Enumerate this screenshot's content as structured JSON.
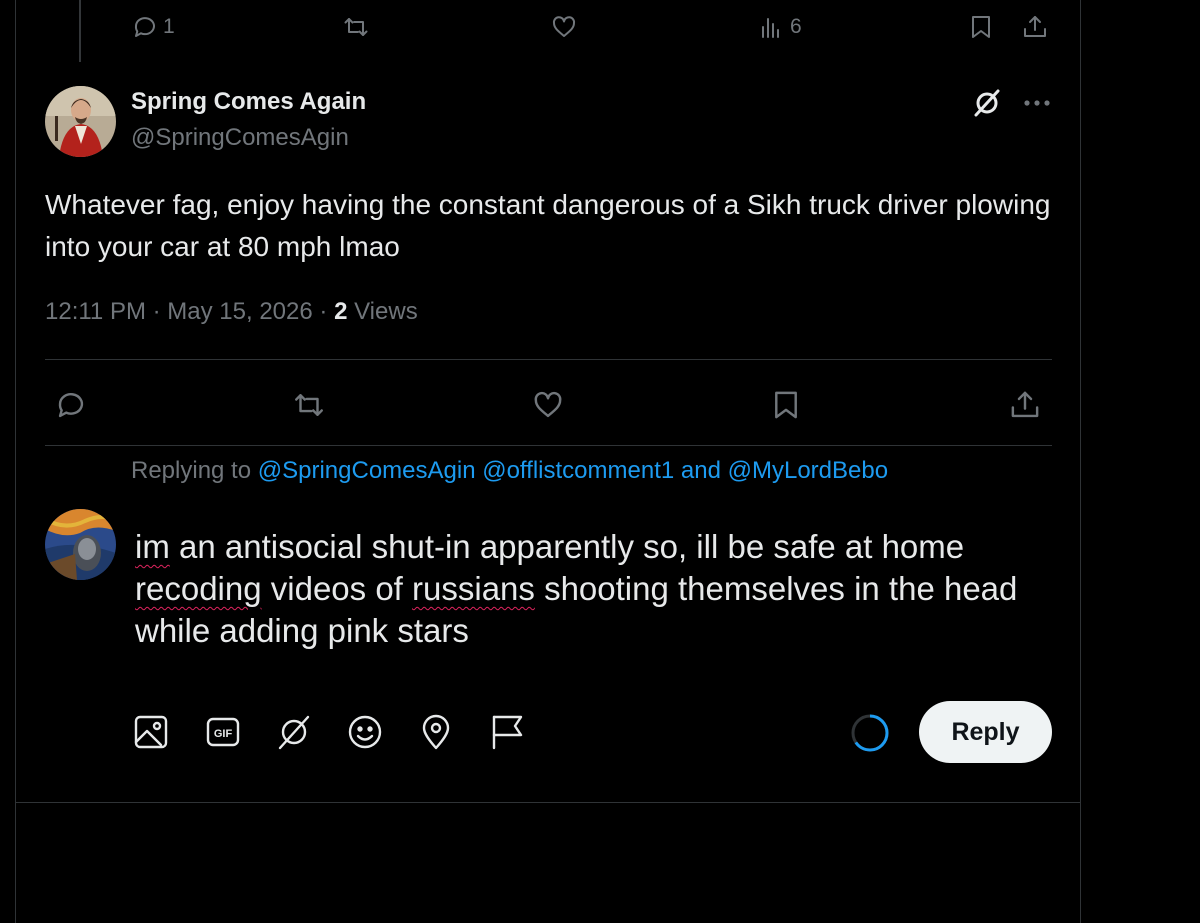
{
  "prev_tweet": {
    "reply_count": "1",
    "view_count": "6"
  },
  "tweet": {
    "author_name": "Spring Comes Again",
    "author_handle": "@SpringComesAgin",
    "text": "Whatever fag, enjoy having the constant dangerous of a Sikh truck driver plowing into your car at 80 mph lmao",
    "time": "12:11 PM",
    "date": "May 15, 2026",
    "views_count": "2",
    "views_label": "Views",
    "separator": "·"
  },
  "reply": {
    "replying_to_label": "Replying to",
    "mention_1": "@SpringComesAgin",
    "mention_2": "@offlistcomment1",
    "and_label": "and",
    "mention_3": "@MyLordBebo",
    "draft": {
      "word_im": "im",
      "part_1": " an antisocial shut-in apparently so, ill be safe at home ",
      "word_recoding": "recoding",
      "part_2": " videos of ",
      "word_russians": "russians",
      "part_3": " shooting themselves in the head while adding pink stars"
    },
    "button_label": "Reply"
  },
  "icons": {
    "reply": "reply-icon",
    "repost": "repost-icon",
    "like": "heart-icon",
    "views": "views-icon",
    "bookmark": "bookmark-icon",
    "share": "share-icon",
    "grok": "grok-icon",
    "more": "more-icon",
    "media": "image-icon",
    "gif": "gif-icon",
    "grok_tool": "grok-icon",
    "emoji": "emoji-icon",
    "location": "location-icon",
    "schedule": "flag-icon"
  },
  "colors": {
    "background": "#000000",
    "text": "#e7e9ea",
    "muted": "#71767b",
    "accent": "#1d9bf0",
    "spellcheck": "#e0245e"
  }
}
